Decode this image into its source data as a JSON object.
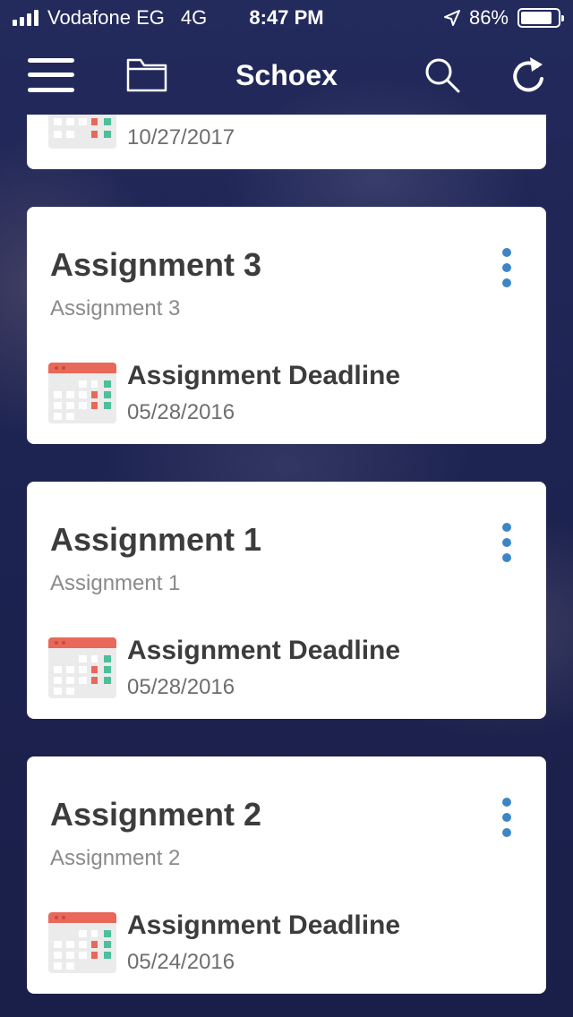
{
  "status_bar": {
    "carrier": "Vodafone EG",
    "network": "4G",
    "time": "8:47 PM",
    "battery": "86%",
    "battery_level": 0.86
  },
  "navbar": {
    "title": "Schoex",
    "icons": [
      "hamburger-menu-icon",
      "folder-icon",
      "search-icon",
      "refresh-icon"
    ]
  },
  "partial_card": {
    "date": "10/27/2017"
  },
  "assignments": [
    {
      "title": "Assignment 3",
      "subtitle": "Assignment 3",
      "deadline_label": "Assignment Deadline",
      "deadline_date": "05/28/2016"
    },
    {
      "title": "Assignment 1",
      "subtitle": "Assignment 1",
      "deadline_label": "Assignment Deadline",
      "deadline_date": "05/28/2016"
    },
    {
      "title": "Assignment 2",
      "subtitle": "Assignment 2",
      "deadline_label": "Assignment Deadline",
      "deadline_date": "05/24/2016"
    }
  ],
  "colors": {
    "background": "#1e2552",
    "card": "#ffffff",
    "accent_dots": "#3d86c6",
    "calendar_red": "#e8685a",
    "calendar_green": "#4dbf9a"
  }
}
